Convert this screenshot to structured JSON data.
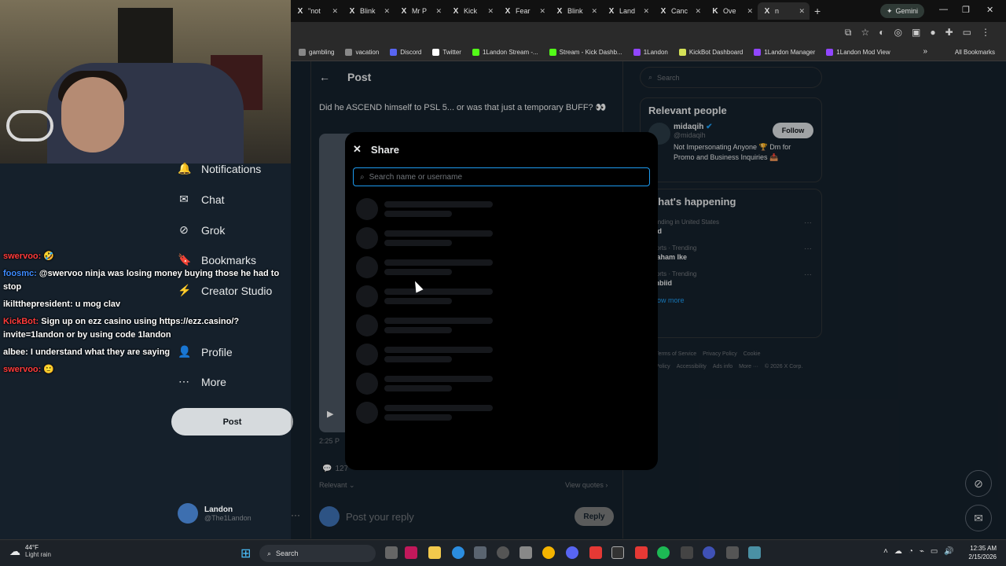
{
  "browser": {
    "tabs": [
      {
        "icon": "X",
        "label": "\"not"
      },
      {
        "icon": "X",
        "label": "Blink"
      },
      {
        "icon": "X",
        "label": "Mr P"
      },
      {
        "icon": "X",
        "label": "Kick"
      },
      {
        "icon": "X",
        "label": "Fear"
      },
      {
        "icon": "X",
        "label": "Blink"
      },
      {
        "icon": "X",
        "label": "Land"
      },
      {
        "icon": "X",
        "label": "Canc"
      },
      {
        "icon": "K",
        "label": "Ove"
      },
      {
        "icon": "X",
        "label": "n"
      }
    ],
    "new_tab": "+",
    "gemini_label": "Gemini",
    "bookmarks": [
      {
        "label": "gambling",
        "color": "#888"
      },
      {
        "label": "vacation",
        "color": "#888"
      },
      {
        "label": "Discord",
        "color": "#5865f2"
      },
      {
        "label": "Twitter",
        "color": "#ffffff"
      },
      {
        "label": "1Landon Stream -...",
        "color": "#53fc18"
      },
      {
        "label": "Stream - Kick Dashb...",
        "color": "#53fc18"
      },
      {
        "label": "1Landon",
        "color": "#9146ff"
      },
      {
        "label": "KickBot Dashboard",
        "color": "#d4e157"
      },
      {
        "label": "1Landon Manager",
        "color": "#9146ff"
      },
      {
        "label": "1Landon Mod View",
        "color": "#9146ff"
      }
    ],
    "all_bookmarks": "All Bookmarks",
    "bookmarks_more": "»"
  },
  "nav": {
    "items": [
      {
        "icon": "bell-icon",
        "glyph": "🔔",
        "label": "Notifications"
      },
      {
        "icon": "mail-icon",
        "glyph": "✉",
        "label": "Chat"
      },
      {
        "icon": "grok-icon",
        "glyph": "⊘",
        "label": "Grok"
      },
      {
        "icon": "bookmark-icon",
        "glyph": "🔖",
        "label": "Bookmarks"
      },
      {
        "icon": "lightning-icon",
        "glyph": "⚡",
        "label": "Creator Studio"
      },
      {
        "icon": "person-icon",
        "glyph": "👤",
        "label": "Profile"
      },
      {
        "icon": "more-icon",
        "glyph": "⋯",
        "label": "More"
      }
    ],
    "post_button": "Post",
    "account_name": "Landon",
    "account_handle": "@The1Landon",
    "account_more": "···"
  },
  "chat": [
    {
      "user": "swervoo:",
      "user_color": "#ff3b3b",
      "text": "🤣"
    },
    {
      "user": "foosmc:",
      "user_color": "#3d8bff",
      "text": "@swervoo ninja was losing money buying those he had to stop"
    },
    {
      "user": "ikiltthepresident:",
      "user_color": "#ffffff",
      "text": "u mog clav"
    },
    {
      "user": "KickBot:",
      "user_color": "#ff3b3b",
      "text": "Sign up on ezz casino using https://ezz.casino/?invite=1landon or by using code 1landon"
    },
    {
      "user": "albee:",
      "user_color": "#ffffff",
      "text": "I understand what they are saying"
    },
    {
      "user": "swervoo:",
      "user_color": "#ff3b3b",
      "text": "🙂"
    }
  ],
  "post": {
    "back": "←",
    "header": "Post",
    "text": "Did he ASCEND himself to PSL 5... or was that just a temporary BUFF? 👀",
    "time": "2:25 P",
    "replies": "127",
    "relevant": "Relevant",
    "view_quotes": "View quotes",
    "reply_placeholder": "Post your reply",
    "reply_button": "Reply"
  },
  "right": {
    "search_placeholder": "Search",
    "relevant_title": "Relevant people",
    "person": {
      "name": "midaqih",
      "handle": "@midaqih",
      "bio": "Not Impersonating Anyone 🏆 Dm for Promo and Business Inquiries 📥",
      "follow": "Follow"
    },
    "happening_title": "What's happening",
    "trends": [
      {
        "meta": "Trending in United States",
        "title": "Bad"
      },
      {
        "meta": "Sports · Trending",
        "title": "Graham Ike"
      },
      {
        "meta": "Sports · Trending",
        "title": "Embiid"
      }
    ],
    "show_more": "Show more",
    "footer": [
      "Terms of Service",
      "Privacy Policy",
      "Cookie Policy",
      "Accessibility",
      "Ads info",
      "More ···",
      "© 2026 X Corp."
    ]
  },
  "modal": {
    "close": "✕",
    "title": "Share",
    "search_placeholder": "Search name or username",
    "skeleton_rows": 8
  },
  "taskbar": {
    "temp": "44°F",
    "condition": "Light rain",
    "search": "Search",
    "time": "12:35 AM",
    "date": "2/15/2026"
  }
}
